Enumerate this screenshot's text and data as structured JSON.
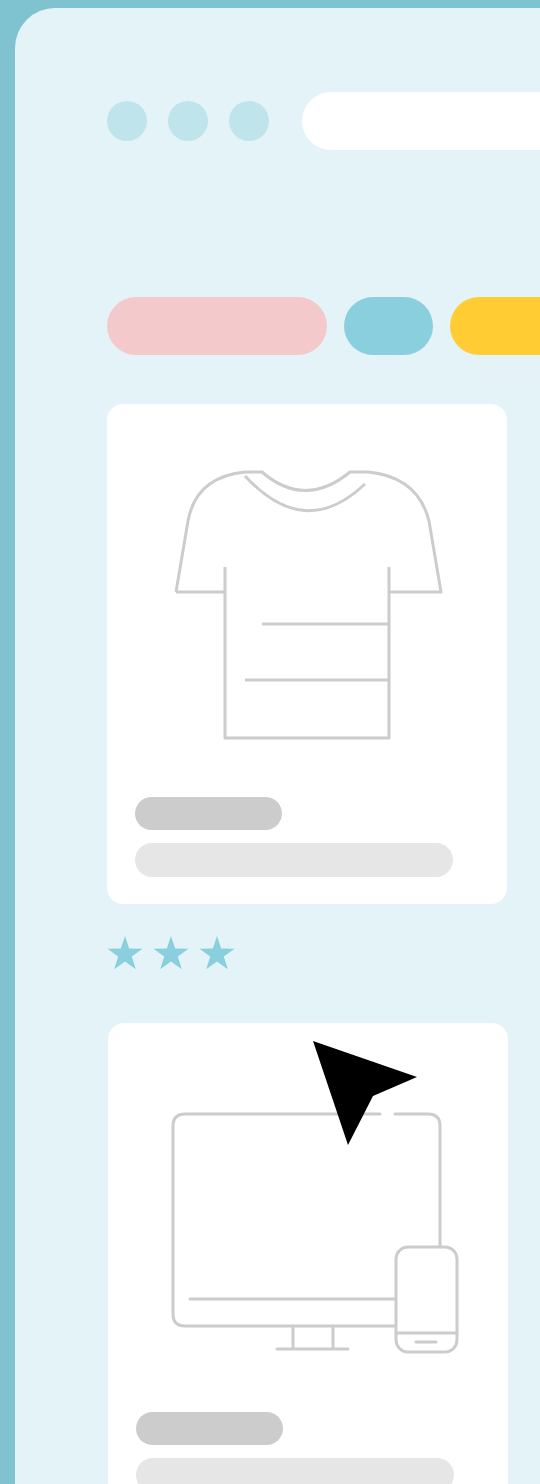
{
  "tags": [
    {
      "color": "#f4c9cb"
    },
    {
      "color": "#8acfdd"
    },
    {
      "color": "#ffcc33"
    }
  ],
  "products": [
    {
      "kind": "shirt",
      "stars": 3
    },
    {
      "kind": "devices"
    }
  ]
}
